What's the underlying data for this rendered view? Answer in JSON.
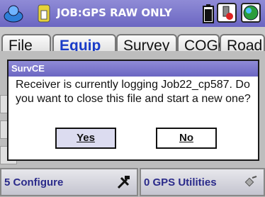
{
  "topbar": {
    "title": "JOB:GPS RAW ONLY",
    "logo_icon": "surveyor-logo-icon",
    "job_icon": "job-file-icon",
    "battery_icon": "battery-icon",
    "tool_icon": "instrument-tool-icon",
    "globe_icon": "globe-icon"
  },
  "tabs": [
    {
      "label": "File"
    },
    {
      "label": "Equip",
      "active": true
    },
    {
      "label": "Survey"
    },
    {
      "label": "COGO"
    },
    {
      "label": "Road"
    }
  ],
  "bottom": {
    "configure_label": "5 Configure",
    "configure_icon": "wrench-hammer-icon",
    "gps_utilities_label": "0 GPS Utilities",
    "gps_utilities_icon": "satellite-icon"
  },
  "dialog": {
    "title": "SurvCE",
    "message": "Receiver is currently logging Job22_cp587. Do you want to close this file and start a new one?",
    "yes_label": "Yes",
    "no_label": "No"
  },
  "colors": {
    "titlebar": "#7a76cc",
    "accent_text": "#1a3cc8",
    "button_text": "#2a2a8a"
  }
}
